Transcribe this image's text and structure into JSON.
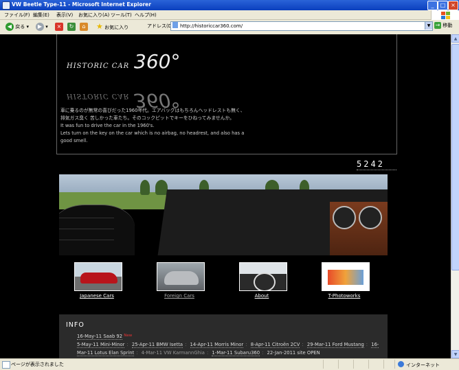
{
  "window": {
    "title": "VW Beetle Type-11 - Microsoft Internet Explorer",
    "minimize": "_",
    "maximize": "□",
    "close": "×"
  },
  "menu": [
    "ファイル(F)",
    "編集(E)",
    "表示(V)",
    "お気に入り(A)",
    "ツール(T)",
    "ヘルプ(H)"
  ],
  "toolbar": {
    "back": "戻る",
    "favorites": "お気に入り",
    "address_label": "アドレス(D)",
    "address_value": "http://historiccar360.com/",
    "go": "移動"
  },
  "site": {
    "logo_text": "HISTORIC CAR",
    "logo_number": "360°",
    "description": [
      "車に乗るのが無常の喜びだった1960年代。エアバッグはもちろんヘッドレストも無く、",
      "排気ガス臭く 苦しかった車たち。そのコックピットでキーをひねってみませんか。",
      "It was fun to drive the car in the 1960's.",
      "Lets turn on the key on the car which is no airbag, no headrest, and also has a",
      "good smell."
    ],
    "counter": "5242",
    "thumbs": [
      {
        "label": "Japanese Cars"
      },
      {
        "label": "Foreign Cars"
      },
      {
        "label": "About"
      },
      {
        "label": "T-Photoworks"
      }
    ],
    "info": {
      "heading": "INFO",
      "first": {
        "date": "16-May-11",
        "name": "Saab 92",
        "badge": "New"
      },
      "row2": [
        {
          "date": "5-May-11",
          "name": "Mini-Minor"
        },
        {
          "date": "25-Apr-11",
          "name": "BMW Isetta"
        },
        {
          "date": "14-Apr-11",
          "name": "Morris Minor"
        },
        {
          "date": "8-Apr-11",
          "name": "Citroën 2CV"
        },
        {
          "date": "29-Mar-11",
          "name": "Ford Mustang"
        },
        {
          "date": "16-",
          "name": ""
        }
      ],
      "row3": [
        {
          "date": "Mar-11",
          "name": "Lotus Elan Sprint"
        },
        {
          "date": "4-Mar-11",
          "name": "VW KarmannGhia"
        },
        {
          "date": "1-Mar-11",
          "name": "Subaru360"
        },
        {
          "date": "22-Jan-2011",
          "name": "site OPEN"
        }
      ]
    }
  },
  "status": {
    "text": "ページが表示されました",
    "zone": "インターネット"
  },
  "colors": {
    "titlebar": "#0a3fbe",
    "chrome": "#ece9d8",
    "page_bg": "#000000",
    "info_bg": "#2b2b2b",
    "new_badge": "#ee3333"
  }
}
